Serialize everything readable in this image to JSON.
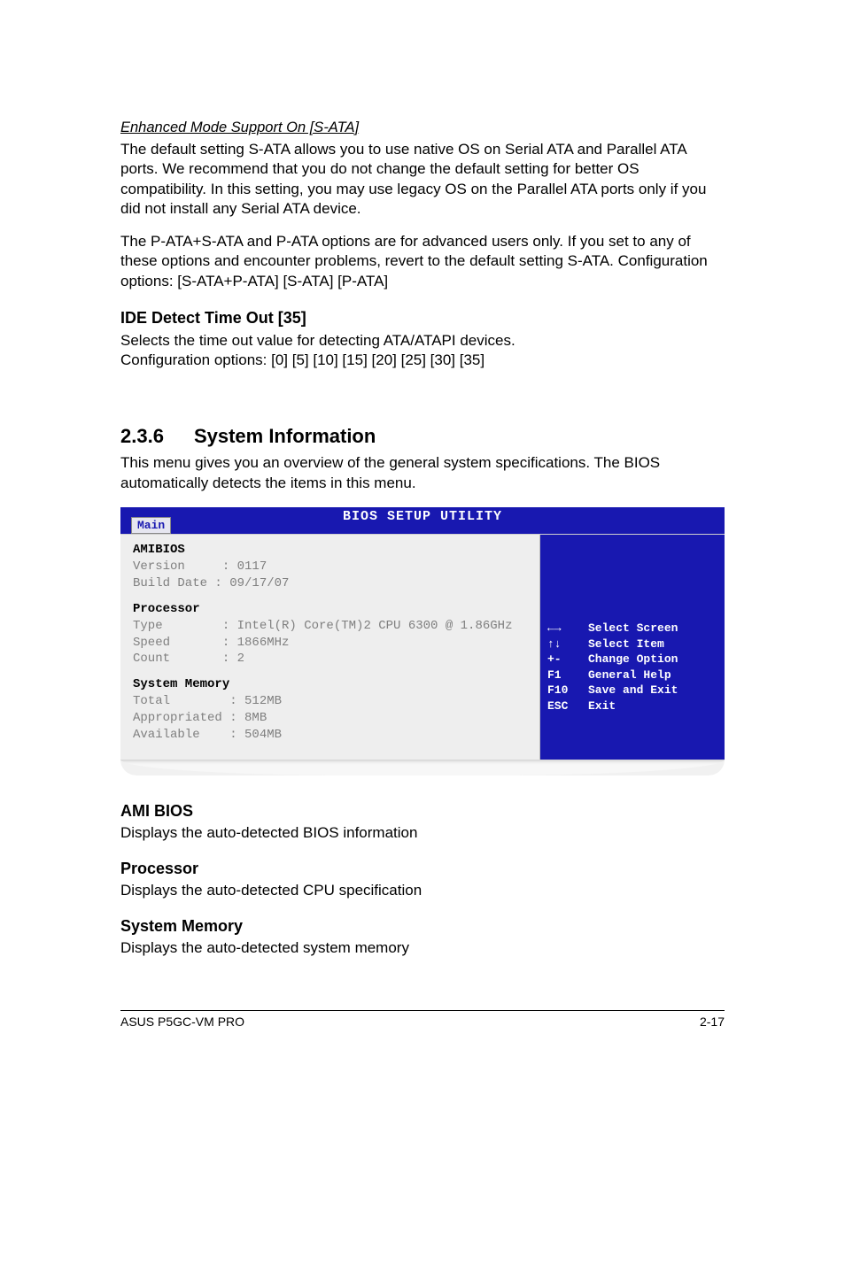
{
  "section_enhanced": {
    "title": "Enhanced Mode Support On [S-ATA]",
    "p1": "The default setting S-ATA allows you to use native OS on Serial ATA and Parallel ATA ports. We recommend that you do not change the default setting for better OS compatibility. In this setting, you may use legacy OS on the Parallel ATA ports only if you did not install any Serial ATA device.",
    "p2": "The P-ATA+S-ATA and P-ATA options are for advanced users only. If you set to any of these options and encounter problems, revert to the default setting S-ATA. Configuration options: [S-ATA+P-ATA] [S-ATA] [P-ATA]"
  },
  "ide_detect": {
    "heading": "IDE Detect Time Out [35]",
    "p1": "Selects the time out value for detecting ATA/ATAPI devices.",
    "p2": "Configuration options: [0] [5] [10] [15] [20] [25] [30] [35]"
  },
  "sysinfo": {
    "num": "2.3.6",
    "title": "System Information",
    "intro": "This menu gives you an overview of the general system specifications. The BIOS automatically detects the items in this menu."
  },
  "bios": {
    "header_tab": "Main",
    "header_title": "BIOS SETUP UTILITY",
    "amibios_label": "AMIBIOS",
    "version_row": "Version     : 0117",
    "build_row": "Build Date : 09/17/07",
    "processor_label": "Processor",
    "proc_type": "Type        : Intel(R) Core(TM)2 CPU 6300 @ 1.86GHz",
    "proc_speed": "Speed       : 1866MHz",
    "proc_count": "Count       : 2",
    "sysmem_label": "System Memory",
    "mem_total": "Total        : 512MB",
    "mem_approp": "Appropriated : 8MB",
    "mem_avail": "Available    : 504MB",
    "help": [
      {
        "key": "←→",
        "label": "Select Screen"
      },
      {
        "key": "↑↓",
        "label": "Select Item"
      },
      {
        "key": "+-",
        "label": "Change Option"
      },
      {
        "key": "F1",
        "label": "General Help"
      },
      {
        "key": "F10",
        "label": "Save and Exit"
      },
      {
        "key": "ESC",
        "label": "Exit"
      }
    ]
  },
  "ami_bios": {
    "heading": "AMI BIOS",
    "text": "Displays the auto-detected BIOS information"
  },
  "processor": {
    "heading": "Processor",
    "text": "Displays the auto-detected CPU specification"
  },
  "system_memory": {
    "heading": "System Memory",
    "text": "Displays the auto-detected system memory"
  },
  "footer": {
    "left": "ASUS P5GC-VM PRO",
    "right": "2-17"
  }
}
